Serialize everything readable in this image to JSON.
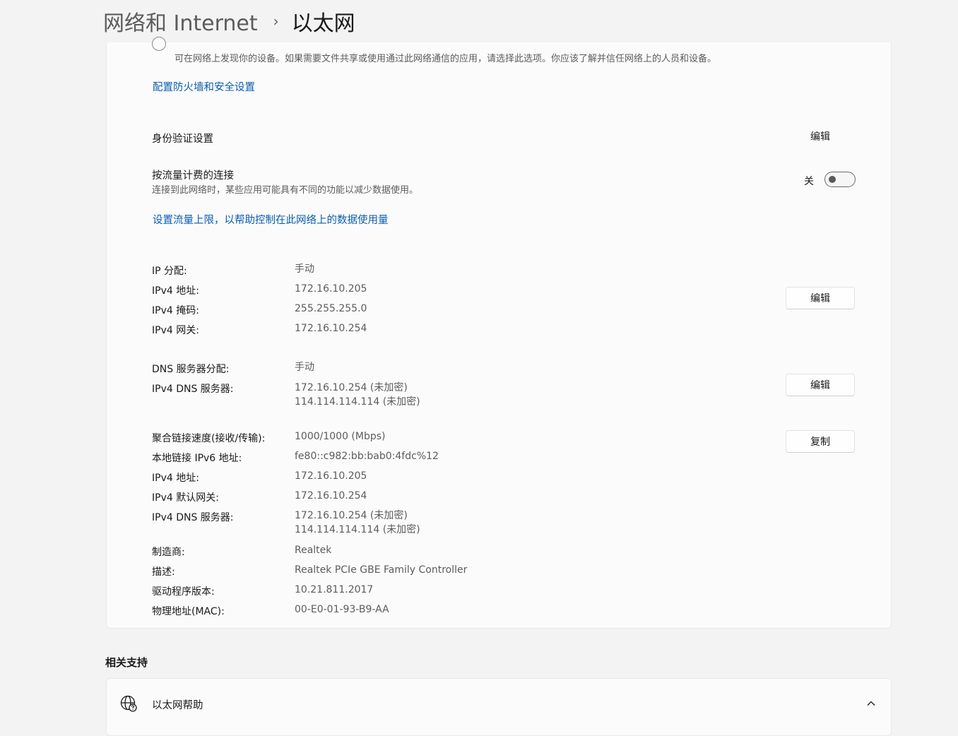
{
  "breadcrumb": {
    "parent": "网络和 Internet",
    "separator": "›",
    "current": "以太网"
  },
  "network_profile": {
    "private_description": "可在网络上发现你的设备。如果需要文件共享或使用通过此网络通信的应用，请选择此选项。你应该了解并信任网络上的人员和设备。",
    "firewall_link": "配置防火墙和安全设置"
  },
  "authentication": {
    "label": "身份验证设置",
    "button": "编辑"
  },
  "metered": {
    "label": "按流量计费的连接",
    "description": "连接到此网络时，某些应用可能具有不同的功能以减少数据使用。",
    "state_label": "关",
    "is_on": false,
    "data_limit_link": "设置流量上限，以帮助控制在此网络上的数据使用量"
  },
  "ip_settings": {
    "button": "编辑",
    "rows": [
      {
        "key": "IP 分配:",
        "value": "手动"
      },
      {
        "key": "IPv4 地址:",
        "value": "172.16.10.205"
      },
      {
        "key": "IPv4 掩码:",
        "value": "255.255.255.0"
      },
      {
        "key": "IPv4 网关:",
        "value": "172.16.10.254"
      }
    ]
  },
  "dns_settings": {
    "button": "编辑",
    "rows": [
      {
        "key": "DNS 服务器分配:",
        "value": "手动"
      },
      {
        "key": "IPv4 DNS 服务器:",
        "value": "172.16.10.254 (未加密)",
        "value2": "114.114.114.114 (未加密)"
      }
    ]
  },
  "properties": {
    "button": "复制",
    "rows": [
      {
        "key": "聚合链接速度(接收/传输):",
        "value": "1000/1000 (Mbps)"
      },
      {
        "key": "本地链接 IPv6 地址:",
        "value": "fe80::c982:bb:bab0:4fdc%12"
      },
      {
        "key": "IPv4 地址:",
        "value": "172.16.10.205"
      },
      {
        "key": "IPv4 默认网关:",
        "value": "172.16.10.254"
      },
      {
        "key": "IPv4 DNS 服务器:",
        "value": "172.16.10.254 (未加密)",
        "value2": "114.114.114.114 (未加密)"
      },
      {
        "key": "制造商:",
        "value": "Realtek"
      },
      {
        "key": "描述:",
        "value": "Realtek PCIe GBE Family Controller"
      },
      {
        "key": "驱动程序版本:",
        "value": "10.21.811.2017"
      },
      {
        "key": "物理地址(MAC):",
        "value": "00-E0-01-93-B9-AA"
      }
    ]
  },
  "related_support": {
    "title": "相关支持",
    "items": [
      {
        "label": "以太网帮助",
        "icon": "globe-help-icon",
        "expanded": true
      }
    ]
  },
  "colors": {
    "link": "#0b5cad",
    "background": "#f3f3f3",
    "card": "#fbfbfb"
  }
}
